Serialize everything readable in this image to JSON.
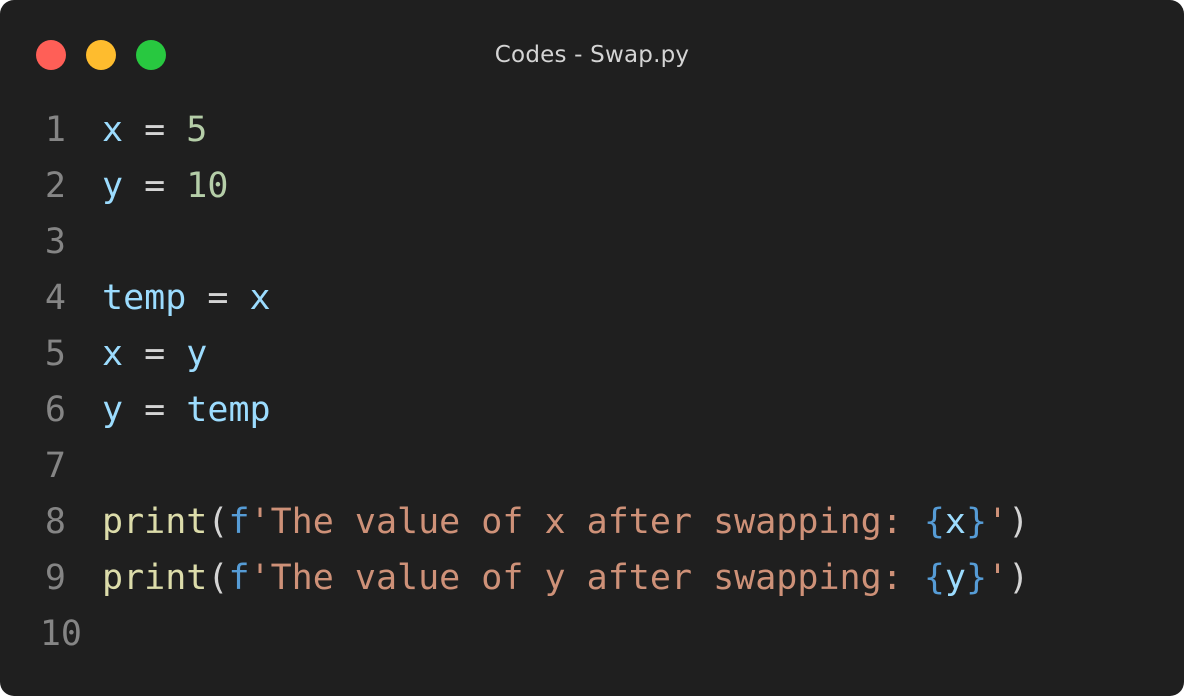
{
  "window": {
    "title": "Codes - Swap.py",
    "controls": {
      "close_color": "#ff5f57",
      "minimize_color": "#febc2e",
      "maximize_color": "#28c840"
    }
  },
  "editor": {
    "language": "python",
    "lines": [
      {
        "number": "1",
        "tokens": [
          {
            "type": "var",
            "text": "x"
          },
          {
            "type": "op",
            "text": " = "
          },
          {
            "type": "num",
            "text": "5"
          }
        ]
      },
      {
        "number": "2",
        "tokens": [
          {
            "type": "var",
            "text": "y"
          },
          {
            "type": "op",
            "text": " = "
          },
          {
            "type": "num",
            "text": "10"
          }
        ]
      },
      {
        "number": "3",
        "tokens": []
      },
      {
        "number": "4",
        "tokens": [
          {
            "type": "var",
            "text": "temp"
          },
          {
            "type": "op",
            "text": " = "
          },
          {
            "type": "var",
            "text": "x"
          }
        ]
      },
      {
        "number": "5",
        "tokens": [
          {
            "type": "var",
            "text": "x"
          },
          {
            "type": "op",
            "text": " = "
          },
          {
            "type": "var",
            "text": "y"
          }
        ]
      },
      {
        "number": "6",
        "tokens": [
          {
            "type": "var",
            "text": "y"
          },
          {
            "type": "op",
            "text": " = "
          },
          {
            "type": "var",
            "text": "temp"
          }
        ]
      },
      {
        "number": "7",
        "tokens": []
      },
      {
        "number": "8",
        "tokens": [
          {
            "type": "fn",
            "text": "print"
          },
          {
            "type": "paren",
            "text": "("
          },
          {
            "type": "kw",
            "text": "f"
          },
          {
            "type": "str",
            "text": "'The value of x after swapping: "
          },
          {
            "type": "kw",
            "text": "{"
          },
          {
            "type": "var",
            "text": "x"
          },
          {
            "type": "kw",
            "text": "}"
          },
          {
            "type": "str",
            "text": "'"
          },
          {
            "type": "paren",
            "text": ")"
          }
        ]
      },
      {
        "number": "9",
        "tokens": [
          {
            "type": "fn",
            "text": "print"
          },
          {
            "type": "paren",
            "text": "("
          },
          {
            "type": "kw",
            "text": "f"
          },
          {
            "type": "str",
            "text": "'The value of y after swapping: "
          },
          {
            "type": "kw",
            "text": "{"
          },
          {
            "type": "var",
            "text": "y"
          },
          {
            "type": "kw",
            "text": "}"
          },
          {
            "type": "str",
            "text": "'"
          },
          {
            "type": "paren",
            "text": ")"
          }
        ]
      },
      {
        "number": "10",
        "tokens": []
      }
    ]
  }
}
